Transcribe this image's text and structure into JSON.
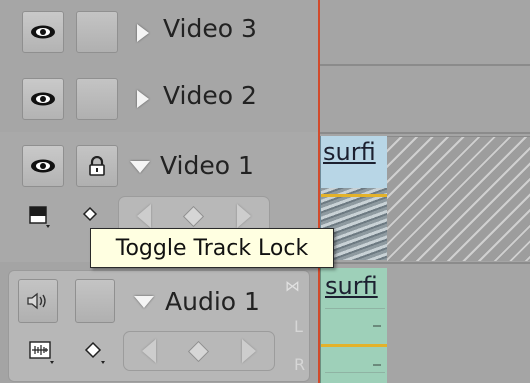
{
  "tracks": {
    "video3": {
      "name": "Video 3"
    },
    "video2": {
      "name": "Video 2"
    },
    "video1": {
      "name": "Video 1"
    },
    "audio1": {
      "name": "Audio 1"
    }
  },
  "clips": {
    "video1_clip": {
      "label": "surfi"
    },
    "audio1_clip": {
      "label": "surfi"
    }
  },
  "audio_channels": {
    "left": "L",
    "right": "R"
  },
  "tooltip": {
    "text": "Toggle Track Lock"
  },
  "colors": {
    "playhead": "#d24a2b",
    "video_clip": "#b8d6e6",
    "audio_clip": "#9ed0b9",
    "keyframe_line": "#e3b22a",
    "tooltip_bg": "#ffffe1"
  },
  "icons": {
    "eye": "eye-icon",
    "lock": "lock-icon",
    "speaker": "speaker-icon",
    "collapse": "triangle-right-icon",
    "expand": "triangle-down-icon",
    "display_style": "display-style-icon",
    "keyframe": "keyframe-icon",
    "prev_keyframe": "prev-keyframe-icon",
    "add_keyframe": "add-keyframe-icon",
    "next_keyframe": "next-keyframe-icon",
    "waveform": "waveform-display-icon",
    "link": "link-icon"
  }
}
